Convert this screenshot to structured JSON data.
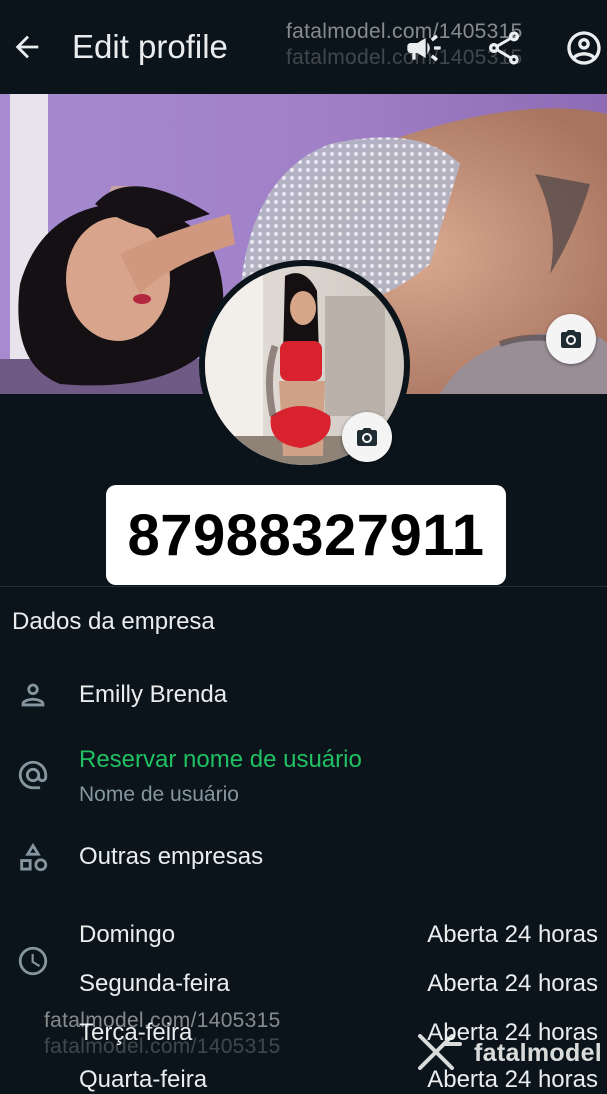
{
  "header": {
    "title": "Edit profile",
    "back_icon": "arrow-left-icon",
    "icons": [
      "megaphone-icon",
      "share-icon",
      "account-circle-icon"
    ]
  },
  "watermarks": {
    "top": "fatalmodel.com/1405315",
    "top_shadow": "fatalmodel.com/1405315",
    "bottom": "fatalmodel.com/1405315",
    "bottom_shadow": "fatalmodel.com/1405315",
    "logo_text": "fatalmodel"
  },
  "profile": {
    "phone": "87988327911",
    "cover_camera_icon": "camera-icon",
    "avatar_camera_icon": "camera-icon"
  },
  "business": {
    "section_title": "Dados da empresa",
    "name": "Emilly Brenda",
    "username_action": "Reservar nome de usuário",
    "username_hint": "Nome de usuário",
    "categories": "Outras empresas",
    "hours": [
      {
        "day": "Domingo",
        "status": "Aberta 24 horas"
      },
      {
        "day": "Segunda-feira",
        "status": "Aberta 24 horas"
      },
      {
        "day": "Terça-feira",
        "status": "Aberta 24 horas"
      },
      {
        "day": "Quarta-feira",
        "status": "Aberta 24 horas"
      }
    ]
  },
  "colors": {
    "background": "#0b141a",
    "accent_green": "#21c063",
    "secondary_text": "#8696a0"
  }
}
